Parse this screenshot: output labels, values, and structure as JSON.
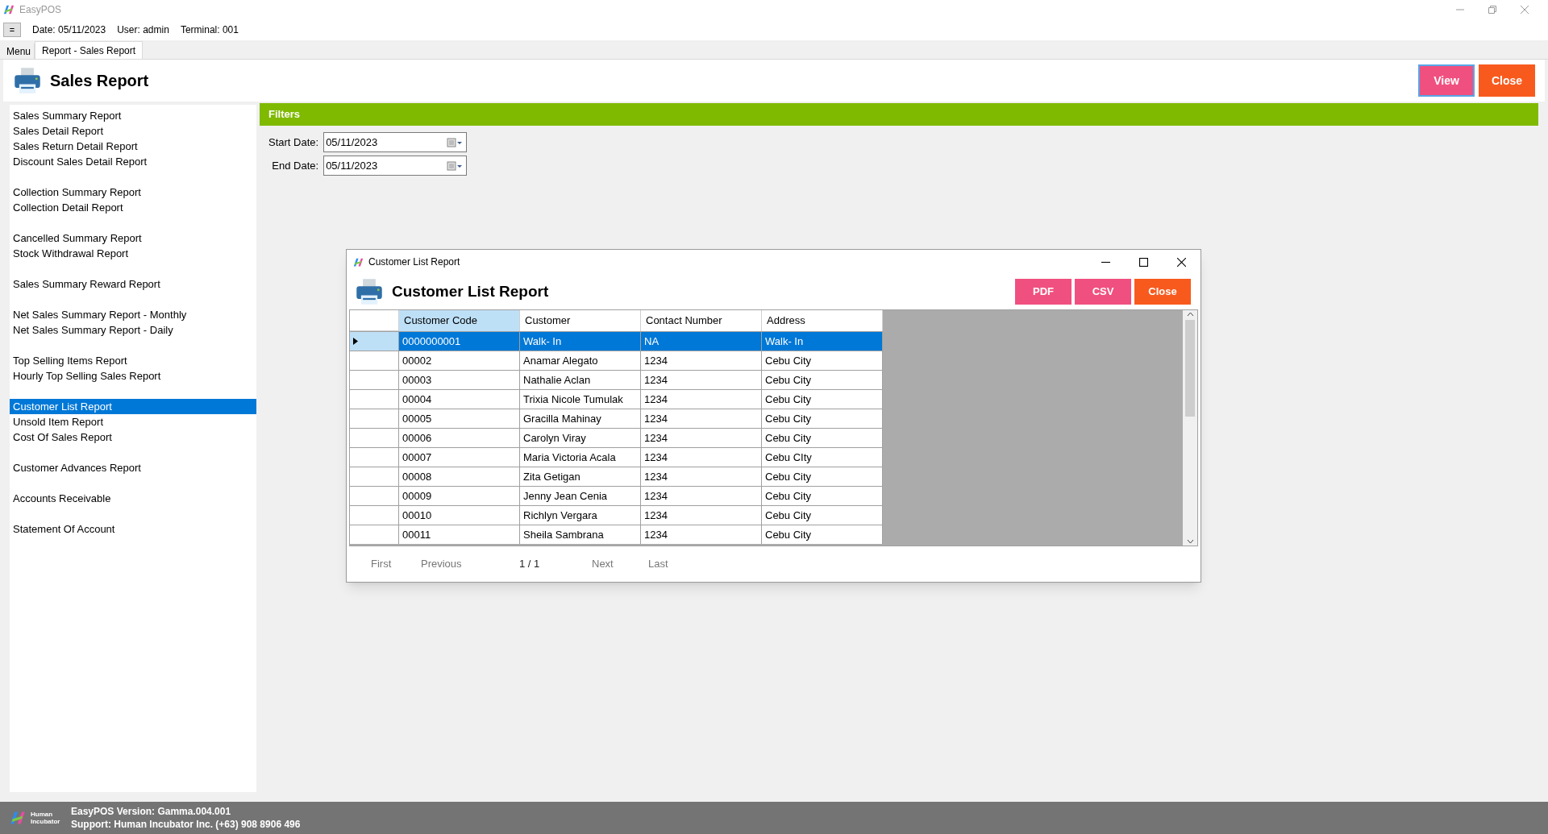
{
  "window": {
    "title": "EasyPOS"
  },
  "info_bar": {
    "menu_button": "=",
    "date": "Date: 05/11/2023",
    "user": "User: admin",
    "terminal": "Terminal: 001"
  },
  "tabs": [
    {
      "label": "Menu",
      "selected": false
    },
    {
      "label": "Report - Sales Report",
      "selected": true
    }
  ],
  "header": {
    "title": "Sales Report",
    "buttons": [
      {
        "label": "View",
        "kind": "primary"
      },
      {
        "label": "Close",
        "kind": "danger"
      }
    ]
  },
  "sidebar": {
    "groups": [
      {
        "items": [
          {
            "label": "Sales Summary Report",
            "selected": false
          },
          {
            "label": "Sales Detail Report",
            "selected": false
          },
          {
            "label": "Sales Return Detail Report",
            "selected": false
          },
          {
            "label": "Discount Sales Detail Report",
            "selected": false
          }
        ]
      },
      {
        "items": [
          {
            "label": "Collection Summary Report",
            "selected": false
          },
          {
            "label": "Collection Detail Report",
            "selected": false
          }
        ]
      },
      {
        "items": [
          {
            "label": "Cancelled Summary Report",
            "selected": false
          },
          {
            "label": "Stock Withdrawal Report",
            "selected": false
          }
        ]
      },
      {
        "items": [
          {
            "label": "Sales Summary Reward Report",
            "selected": false
          }
        ]
      },
      {
        "items": [
          {
            "label": "Net Sales Summary Report - Monthly",
            "selected": false
          },
          {
            "label": "Net Sales Summary Report - Daily",
            "selected": false
          }
        ]
      },
      {
        "items": [
          {
            "label": "Top Selling Items Report",
            "selected": false
          },
          {
            "label": "Hourly Top Selling Sales Report",
            "selected": false
          }
        ]
      },
      {
        "items": [
          {
            "label": "Customer List Report",
            "selected": true
          },
          {
            "label": "Unsold Item Report",
            "selected": false
          },
          {
            "label": "Cost Of Sales Report",
            "selected": false
          }
        ]
      },
      {
        "items": [
          {
            "label": "Customer Advances Report",
            "selected": false
          }
        ]
      },
      {
        "items": [
          {
            "label": "Accounts Receivable",
            "selected": false
          }
        ]
      },
      {
        "items": [
          {
            "label": "Statement Of Account",
            "selected": false
          }
        ]
      }
    ]
  },
  "filters": {
    "title": "Filters",
    "fields": [
      {
        "label": "Start Date:",
        "value": "05/11/2023"
      },
      {
        "label": "End Date:",
        "value": "05/11/2023"
      }
    ]
  },
  "dialog": {
    "title": "Customer List Report",
    "heading": "Customer List Report",
    "buttons": [
      {
        "label": "PDF",
        "kind": "primary"
      },
      {
        "label": "CSV",
        "kind": "primary"
      },
      {
        "label": "Close",
        "kind": "danger"
      }
    ],
    "table": {
      "columns": [
        "Customer Code",
        "Customer",
        "Contact Number",
        "Address"
      ],
      "rows": [
        {
          "cells": [
            "0000000001",
            "Walk- In",
            "NA",
            "Walk- In"
          ],
          "selected": true
        },
        {
          "cells": [
            "00002",
            "Anamar Alegato",
            "1234",
            "Cebu City"
          ],
          "selected": false
        },
        {
          "cells": [
            "00003",
            "Nathalie Aclan",
            "1234",
            "Cebu City"
          ],
          "selected": false
        },
        {
          "cells": [
            "00004",
            "Trixia Nicole Tumulak",
            "1234",
            "Cebu City"
          ],
          "selected": false
        },
        {
          "cells": [
            "00005",
            "Gracilla Mahinay",
            "1234",
            "Cebu City"
          ],
          "selected": false
        },
        {
          "cells": [
            "00006",
            "Carolyn Viray",
            "1234",
            "Cebu City"
          ],
          "selected": false
        },
        {
          "cells": [
            "00007",
            "Maria Victoria Acala",
            "1234",
            "Cebu CIty"
          ],
          "selected": false
        },
        {
          "cells": [
            "00008",
            "Zita Getigan",
            "1234",
            "Cebu City"
          ],
          "selected": false
        },
        {
          "cells": [
            "00009",
            "Jenny Jean Cenia",
            "1234",
            "Cebu City"
          ],
          "selected": false
        },
        {
          "cells": [
            "00010",
            "Richlyn Vergara",
            "1234",
            "Cebu City"
          ],
          "selected": false
        },
        {
          "cells": [
            "00011",
            "Sheila Sambrana",
            "1234",
            "Cebu City"
          ],
          "selected": false
        }
      ]
    },
    "pager": {
      "first": "First",
      "previous": "Previous",
      "page": "1 / 1",
      "next": "Next",
      "last": "Last"
    }
  },
  "status_bar": {
    "logo_text": "Human Incubator",
    "version": "EasyPOS Version: Gamma.004.001",
    "support": "Support: Human Incubator Inc. (+63) 908 8906 496"
  }
}
